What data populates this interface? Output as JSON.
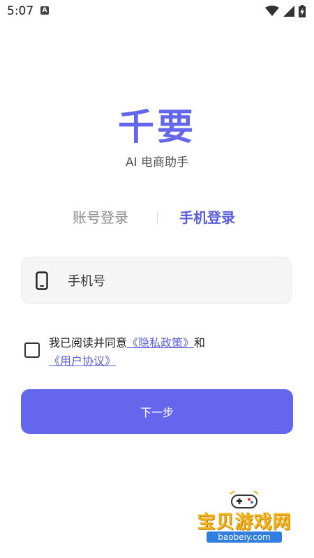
{
  "status_bar": {
    "time": "5:07",
    "notification_badge": "A"
  },
  "brand": {
    "title": "千要",
    "subtitle": "AI 电商助手"
  },
  "tabs": [
    {
      "label": "账号登录",
      "active": false
    },
    {
      "label": "手机登录",
      "active": true
    }
  ],
  "phone_field": {
    "placeholder": "手机号",
    "value": ""
  },
  "agreement": {
    "checked": false,
    "prefix": "我已阅读并同意",
    "privacy_link": "《隐私政策》",
    "conjunction": "和",
    "terms_link": "《用户协议》"
  },
  "next_button": {
    "label": "下一步"
  },
  "watermark": {
    "title": "宝贝游戏网",
    "url": "baobeiy.com"
  },
  "colors": {
    "accent": "#6467ec",
    "tab_active": "#5b5edc",
    "tab_inactive": "#8e8e8e",
    "field_bg": "#f5f5f5"
  }
}
